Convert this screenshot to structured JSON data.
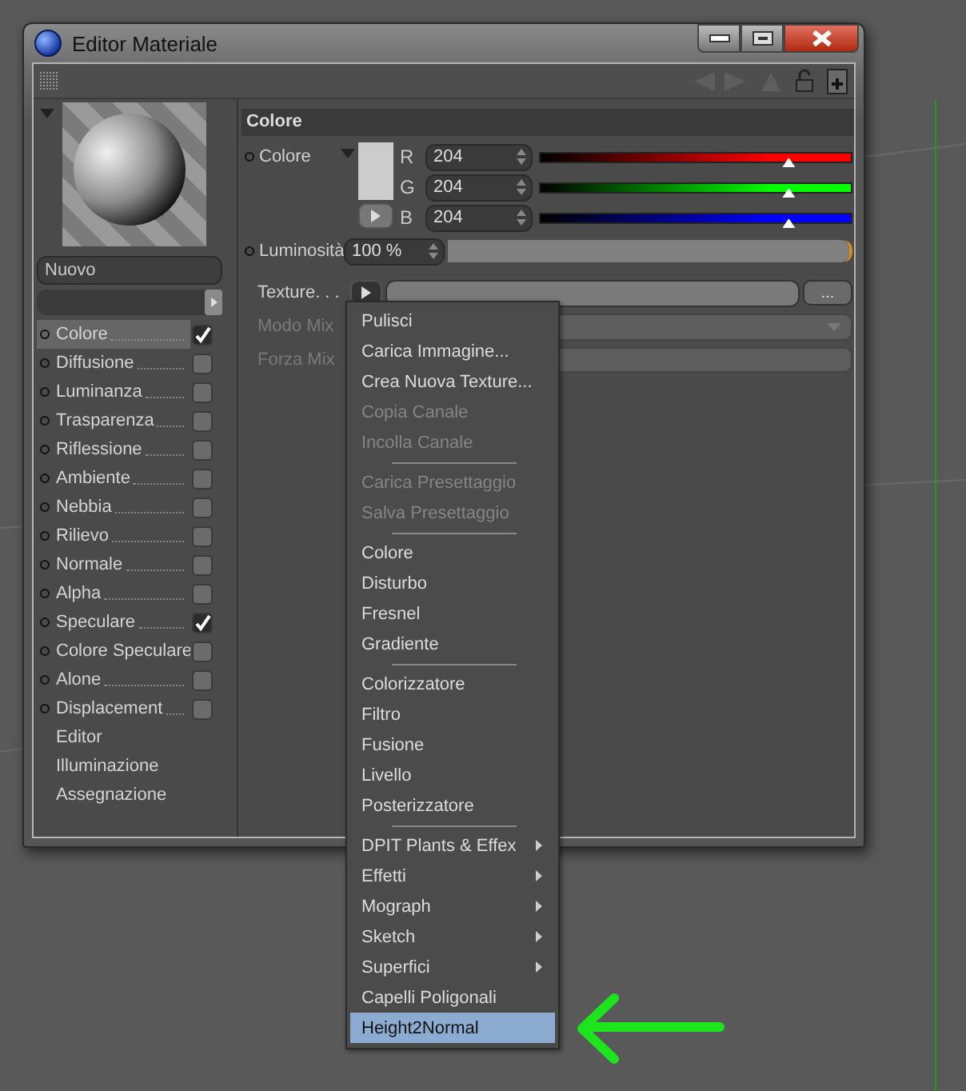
{
  "window": {
    "title": "Editor Materiale"
  },
  "material_name": "Nuovo",
  "channels": [
    {
      "kind": "channel",
      "label": "Colore",
      "checked": true,
      "selected": true
    },
    {
      "kind": "channel",
      "label": "Diffusione",
      "checked": false,
      "selected": false
    },
    {
      "kind": "channel",
      "label": "Luminanza",
      "checked": false,
      "selected": false
    },
    {
      "kind": "channel",
      "label": "Trasparenza",
      "checked": false,
      "selected": false
    },
    {
      "kind": "channel",
      "label": "Riflessione",
      "checked": false,
      "selected": false
    },
    {
      "kind": "channel",
      "label": "Ambiente",
      "checked": false,
      "selected": false
    },
    {
      "kind": "channel",
      "label": "Nebbia",
      "checked": false,
      "selected": false
    },
    {
      "kind": "channel",
      "label": "Rilievo",
      "checked": false,
      "selected": false
    },
    {
      "kind": "channel",
      "label": "Normale",
      "checked": false,
      "selected": false
    },
    {
      "kind": "channel",
      "label": "Alpha",
      "checked": false,
      "selected": false
    },
    {
      "kind": "channel",
      "label": "Speculare",
      "checked": true,
      "selected": false
    },
    {
      "kind": "channel",
      "label": "Colore Speculare",
      "checked": false,
      "selected": false
    },
    {
      "kind": "channel",
      "label": "Alone",
      "checked": false,
      "selected": false
    },
    {
      "kind": "channel",
      "label": "Displacement",
      "checked": false,
      "selected": false
    },
    {
      "kind": "page",
      "label": "Editor",
      "selected": false
    },
    {
      "kind": "page",
      "label": "Illuminazione",
      "selected": false
    },
    {
      "kind": "page",
      "label": "Assegnazione",
      "selected": false
    }
  ],
  "section": {
    "title": "Colore",
    "color": {
      "label": "Colore",
      "channels": [
        {
          "name": "R",
          "value": "204",
          "level": 0.8,
          "color": "#ff0000"
        },
        {
          "name": "G",
          "value": "204",
          "level": 0.8,
          "color": "#00ff00"
        },
        {
          "name": "B",
          "value": "204",
          "level": 0.8,
          "color": "#0000ff"
        }
      ]
    },
    "luminosity": {
      "label": "Luminosità",
      "value": "100 %",
      "level": 1.0
    },
    "texture": {
      "label": "Texture. . .",
      "browse": "..."
    },
    "mix_mode": {
      "label": "Modo Mix",
      "disabled": true
    },
    "mix_strength": {
      "label": "Forza Mix",
      "disabled": true
    }
  },
  "menu": [
    {
      "kind": "item",
      "label": "Pulisci",
      "disabled": false,
      "submenu": false,
      "selected": false
    },
    {
      "kind": "item",
      "label": "Carica Immagine...",
      "disabled": false,
      "submenu": false,
      "selected": false
    },
    {
      "kind": "item",
      "label": "Crea Nuova Texture...",
      "disabled": false,
      "submenu": false,
      "selected": false
    },
    {
      "kind": "item",
      "label": "Copia Canale",
      "disabled": true,
      "submenu": false,
      "selected": false
    },
    {
      "kind": "item",
      "label": "Incolla Canale",
      "disabled": true,
      "submenu": false,
      "selected": false
    },
    {
      "kind": "separator"
    },
    {
      "kind": "item",
      "label": "Carica Presettaggio",
      "disabled": true,
      "submenu": false,
      "selected": false
    },
    {
      "kind": "item",
      "label": "Salva Presettaggio",
      "disabled": true,
      "submenu": false,
      "selected": false
    },
    {
      "kind": "separator"
    },
    {
      "kind": "item",
      "label": "Colore",
      "disabled": false,
      "submenu": false,
      "selected": false
    },
    {
      "kind": "item",
      "label": "Disturbo",
      "disabled": false,
      "submenu": false,
      "selected": false
    },
    {
      "kind": "item",
      "label": "Fresnel",
      "disabled": false,
      "submenu": false,
      "selected": false
    },
    {
      "kind": "item",
      "label": "Gradiente",
      "disabled": false,
      "submenu": false,
      "selected": false
    },
    {
      "kind": "separator"
    },
    {
      "kind": "item",
      "label": "Colorizzatore",
      "disabled": false,
      "submenu": false,
      "selected": false
    },
    {
      "kind": "item",
      "label": "Filtro",
      "disabled": false,
      "submenu": false,
      "selected": false
    },
    {
      "kind": "item",
      "label": "Fusione",
      "disabled": false,
      "submenu": false,
      "selected": false
    },
    {
      "kind": "item",
      "label": "Livello",
      "disabled": false,
      "submenu": false,
      "selected": false
    },
    {
      "kind": "item",
      "label": "Posterizzatore",
      "disabled": false,
      "submenu": false,
      "selected": false
    },
    {
      "kind": "separator"
    },
    {
      "kind": "item",
      "label": "DPIT Plants & Effex",
      "disabled": false,
      "submenu": true,
      "selected": false
    },
    {
      "kind": "item",
      "label": "Effetti",
      "disabled": false,
      "submenu": true,
      "selected": false
    },
    {
      "kind": "item",
      "label": "Mograph",
      "disabled": false,
      "submenu": true,
      "selected": false
    },
    {
      "kind": "item",
      "label": "Sketch",
      "disabled": false,
      "submenu": true,
      "selected": false
    },
    {
      "kind": "item",
      "label": "Superfici",
      "disabled": false,
      "submenu": true,
      "selected": false
    },
    {
      "kind": "item",
      "label": "Capelli Poligonali",
      "disabled": false,
      "submenu": false,
      "selected": false
    },
    {
      "kind": "item",
      "label": "Height2Normal",
      "disabled": false,
      "submenu": false,
      "selected": true
    }
  ]
}
